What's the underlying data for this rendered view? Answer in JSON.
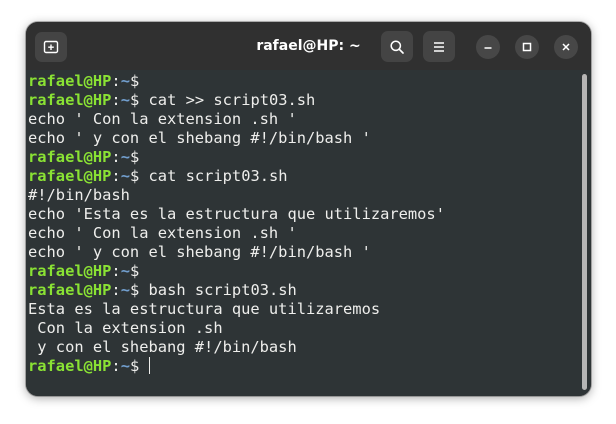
{
  "window": {
    "title": "rafael@HP: ~"
  },
  "prompt": {
    "user_host": "rafael@HP",
    "separator": ":",
    "path": "~",
    "symbol": "$"
  },
  "terminal": {
    "lines": [
      {
        "type": "prompt",
        "command": ""
      },
      {
        "type": "prompt",
        "command": "cat >> script03.sh"
      },
      {
        "type": "output",
        "text": "echo ' Con la extension .sh '"
      },
      {
        "type": "output",
        "text": "echo ' y con el shebang #!/bin/bash '"
      },
      {
        "type": "prompt",
        "command": ""
      },
      {
        "type": "prompt",
        "command": "cat script03.sh"
      },
      {
        "type": "output",
        "text": "#!/bin/bash"
      },
      {
        "type": "output",
        "text": "echo 'Esta es la estructura que utilizaremos'"
      },
      {
        "type": "output",
        "text": "echo ' Con la extension .sh '"
      },
      {
        "type": "output",
        "text": "echo ' y con el shebang #!/bin/bash '"
      },
      {
        "type": "prompt",
        "command": ""
      },
      {
        "type": "prompt",
        "command": "bash script03.sh"
      },
      {
        "type": "output",
        "text": "Esta es la estructura que utilizaremos"
      },
      {
        "type": "output",
        "text": " Con la extension .sh"
      },
      {
        "type": "output",
        "text": " y con el shebang #!/bin/bash"
      },
      {
        "type": "prompt",
        "command": "",
        "cursor": true
      }
    ]
  },
  "icons": {
    "new_tab": "new-tab-icon",
    "search": "search-icon",
    "menu": "hamburger-menu-icon",
    "minimize": "minimize-icon",
    "maximize": "maximize-icon",
    "close": "close-icon"
  },
  "colors": {
    "user_host": "#8ae234",
    "path": "#729fcf",
    "text": "#eeeeec",
    "background": "#2e3436",
    "titlebar": "#303030"
  }
}
